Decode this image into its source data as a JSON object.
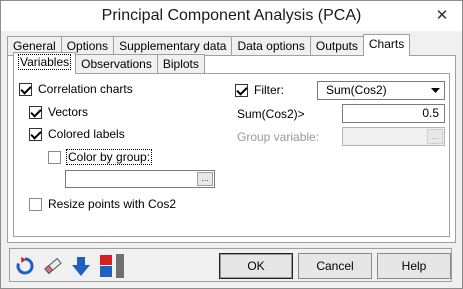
{
  "window": {
    "title": "Principal Component Analysis (PCA)",
    "close_glyph": "✕"
  },
  "tabs": [
    {
      "label": "General"
    },
    {
      "label": "Options"
    },
    {
      "label": "Supplementary data"
    },
    {
      "label": "Data options"
    },
    {
      "label": "Outputs"
    },
    {
      "label": "Charts"
    }
  ],
  "subtabs": [
    {
      "label": "Variables"
    },
    {
      "label": "Observations"
    },
    {
      "label": "Biplots"
    }
  ],
  "variables": {
    "correlation_charts": "Correlation charts",
    "vectors": "Vectors",
    "colored_labels": "Colored labels",
    "color_by_group": "Color by group:",
    "color_by_group_value": "",
    "resize_points": "Resize points with Cos2",
    "filter_label": "Filter:",
    "filter_value": "Sum(Cos2)",
    "sumcos2_label": "Sum(Cos2)>",
    "sumcos2_value": "0.5",
    "group_variable_label": "Group variable:",
    "group_variable_value": "",
    "ellipsis": "..."
  },
  "buttons": {
    "ok": "OK",
    "cancel": "Cancel",
    "help": "Help"
  },
  "icons": [
    "reset-icon",
    "eraser-icon",
    "down-arrow-icon",
    "color-flags-icon"
  ],
  "colors": {
    "accent_blue": "#1f5fc4",
    "red": "#d42020"
  }
}
